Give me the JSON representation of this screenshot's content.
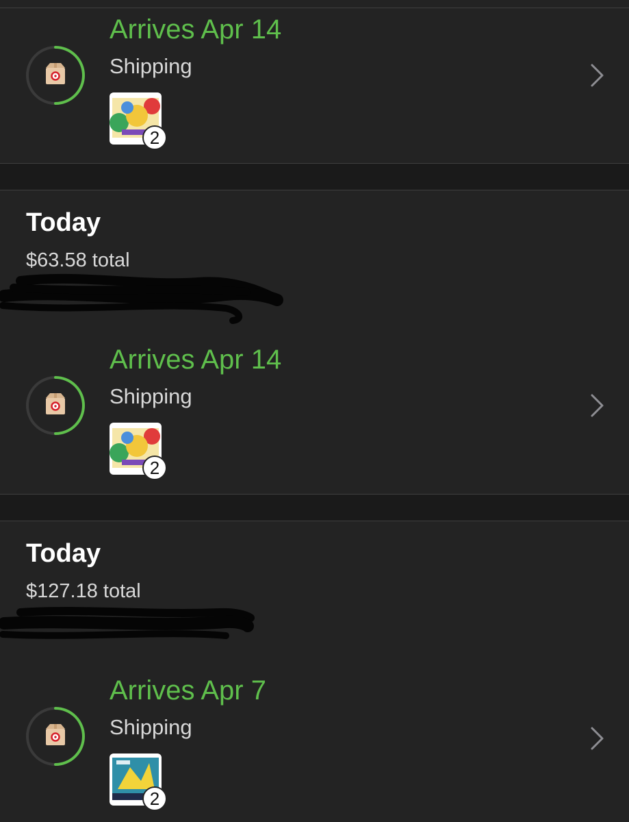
{
  "colors": {
    "background": "#232323",
    "section_gap": "#1a1a1a",
    "divider": "#3f3f3f",
    "accent_green": "#5fbf4c",
    "text_primary": "#ffffff",
    "text_secondary": "#d9d9d9",
    "ring_track": "#3a3a3a"
  },
  "top_shipment": {
    "arrival": "Arrives Apr 14",
    "status": "Shipping",
    "item_quantity": "2",
    "progress": 0.5,
    "icon": "package-icon",
    "action_icon": "chevron-right-icon"
  },
  "orders": [
    {
      "title": "Today",
      "total": "$63.58 total",
      "address_redacted": true,
      "shipment": {
        "arrival": "Arrives Apr 14",
        "status": "Shipping",
        "item_quantity": "2",
        "progress": 0.5,
        "icon": "package-icon",
        "action_icon": "chevron-right-icon"
      }
    },
    {
      "title": "Today",
      "total": "$127.18 total",
      "address_redacted": true,
      "shipment": {
        "arrival": "Arrives Apr 7",
        "status": "Shipping",
        "item_quantity": "2",
        "progress": 0.5,
        "icon": "package-icon",
        "action_icon": "chevron-right-icon"
      }
    }
  ]
}
